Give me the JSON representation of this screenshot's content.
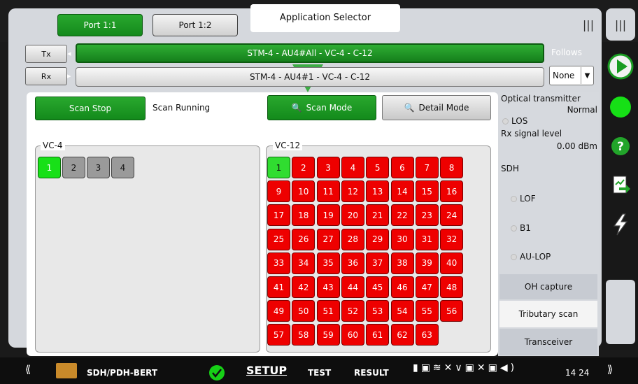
{
  "header": {
    "ports": [
      {
        "label": "Port 1:1",
        "active": true
      },
      {
        "label": "Port 1:2",
        "active": false
      }
    ],
    "app_selector_label": "Application Selector"
  },
  "path": {
    "tx_label": "Tx",
    "rx_label": "Rx",
    "tx_path": "STM-4 - AU4#All - VC-4 - C-12",
    "rx_path": "STM-4 - AU4#1 - VC-4 - C-12",
    "follows_label": "Follows",
    "follows_value": "None"
  },
  "scan": {
    "stop_label": "Scan Stop",
    "status_text": "Scan Running",
    "scan_mode_label": "Scan Mode",
    "detail_mode_label": "Detail Mode"
  },
  "vc4": {
    "label": "VC-4",
    "cells": [
      {
        "n": "1",
        "state": "ok"
      },
      {
        "n": "2",
        "state": "inactive"
      },
      {
        "n": "3",
        "state": "inactive"
      },
      {
        "n": "4",
        "state": "inactive"
      }
    ]
  },
  "vc12": {
    "label": "VC-12",
    "cells": [
      "1",
      "2",
      "3",
      "4",
      "5",
      "6",
      "7",
      "8",
      "9",
      "10",
      "11",
      "12",
      "13",
      "14",
      "15",
      "16",
      "17",
      "18",
      "19",
      "20",
      "21",
      "22",
      "23",
      "24",
      "25",
      "26",
      "27",
      "28",
      "29",
      "30",
      "31",
      "32",
      "33",
      "34",
      "35",
      "36",
      "37",
      "38",
      "39",
      "40",
      "41",
      "42",
      "43",
      "44",
      "45",
      "46",
      "47",
      "48",
      "49",
      "50",
      "51",
      "52",
      "53",
      "54",
      "55",
      "56",
      "57",
      "58",
      "59",
      "60",
      "61",
      "62",
      "63"
    ],
    "ok_cells": [
      "1"
    ]
  },
  "status_panel": {
    "optical_title": "Optical transmitter",
    "optical_value": "Normal",
    "los_label": "LOS",
    "rx_level_label": "Rx signal level",
    "rx_level_value": "0.00 dBm",
    "sdh_label": "SDH",
    "lof_label": "LOF",
    "b1_label": "B1",
    "aulop_label": "AU-LOP"
  },
  "tabs": [
    "OH capture",
    "Tributary scan",
    "Transceiver"
  ],
  "active_tab": "Tributary scan",
  "bottom_bar": {
    "app_name": "SDH/PDH-BERT",
    "setup_label": "SETUP",
    "test_label": "TEST",
    "result_label": "RESULT",
    "clock": "14 24"
  },
  "colors": {
    "green": "#1a9c22",
    "red": "#ee0000",
    "ok_green": "#18e018"
  }
}
